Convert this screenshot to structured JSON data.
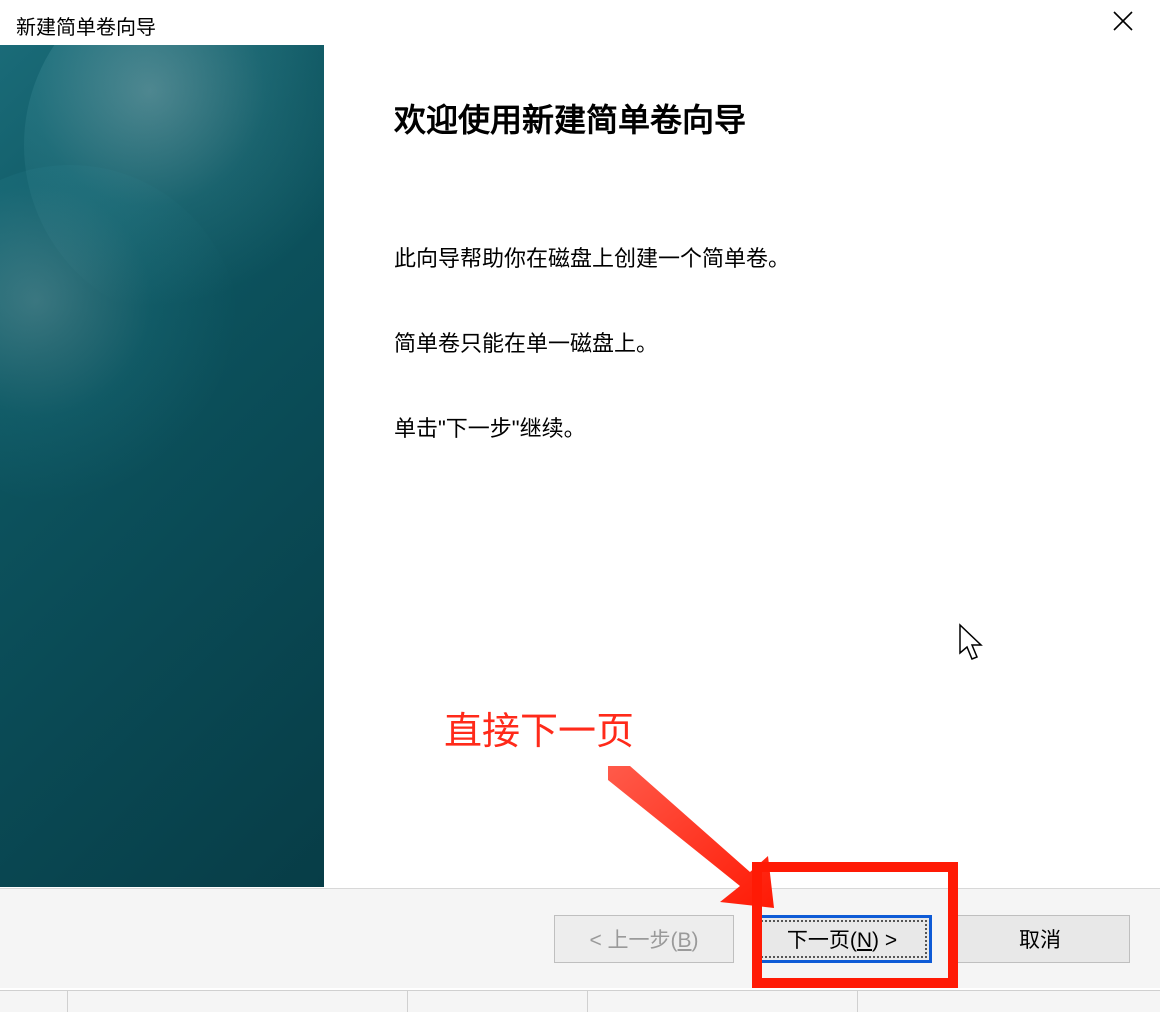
{
  "window": {
    "title": "新建简单卷向导"
  },
  "content": {
    "heading": "欢迎使用新建简单卷向导",
    "paragraph1": "此向导帮助你在磁盘上创建一个简单卷。",
    "paragraph2": "简单卷只能在单一磁盘上。",
    "paragraph3": "单击\"下一步\"继续。"
  },
  "buttons": {
    "back_prefix": "< 上一步(",
    "back_hotkey": "B",
    "back_suffix": ")",
    "next_prefix": "下一页(",
    "next_hotkey": "N",
    "next_suffix": ") >",
    "cancel": "取消"
  },
  "annotation": {
    "label": "直接下一页"
  }
}
